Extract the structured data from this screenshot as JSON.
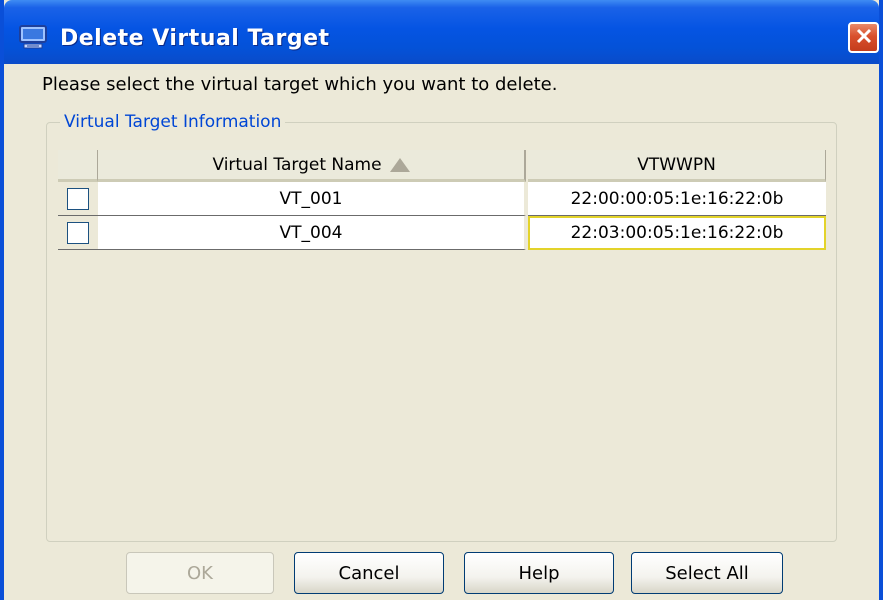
{
  "window": {
    "title": "Delete Virtual Target",
    "close_icon": "close-icon",
    "app_icon": "monitor-icon"
  },
  "instruction": "Please select the virtual target which you want to delete.",
  "group": {
    "legend": "Virtual Target Information"
  },
  "table": {
    "columns": [
      "",
      "Virtual Target Name",
      "VTWWPN"
    ],
    "sort_column": "Virtual Target Name",
    "sort_direction": "ascending",
    "rows": [
      {
        "checked": false,
        "name": "VT_001",
        "wwpn": "22:00:00:05:1e:16:22:0b"
      },
      {
        "checked": false,
        "name": "VT_004",
        "wwpn": "22:03:00:05:1e:16:22:0b"
      }
    ]
  },
  "buttons": {
    "ok": "OK",
    "cancel": "Cancel",
    "help": "Help",
    "select_all": "Select All"
  },
  "colors": {
    "titlebar": "#0554e3",
    "legend": "#0046d5",
    "focus_border": "#e3d32a"
  }
}
